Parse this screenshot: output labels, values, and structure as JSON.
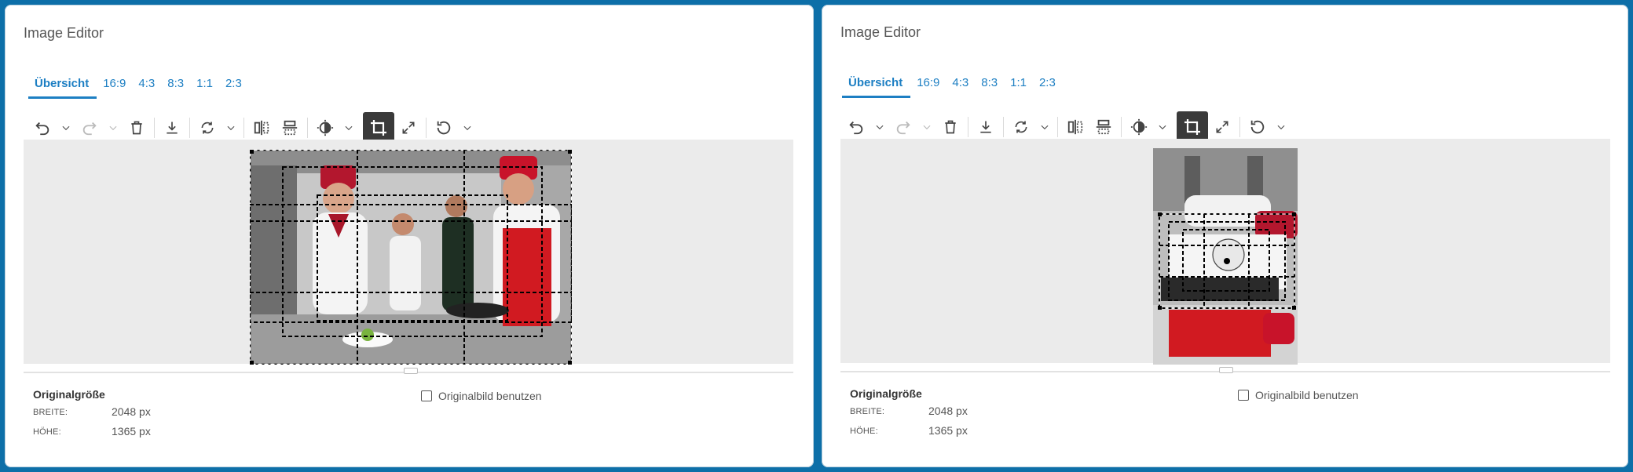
{
  "panels": [
    {
      "title": "Image Editor",
      "tabs": [
        "Übersicht",
        "16:9",
        "4:3",
        "8:3",
        "1:1",
        "2:3"
      ],
      "active_tab": "Übersicht",
      "toolbar": {
        "buttons": [
          "undo-icon",
          "redo-icon",
          "delete-icon",
          "download-icon",
          "rotate-icon",
          "flip-horizontal-icon",
          "flip-vertical-icon",
          "brightness-icon",
          "crop-icon",
          "fullscreen-icon",
          "reset-icon"
        ],
        "active": "crop-icon",
        "disabled": [
          "redo-icon"
        ]
      },
      "image_orientation": "landscape",
      "original": {
        "heading": "Originalgröße",
        "width_label": "BREITE:",
        "width_value": "2048 px",
        "height_label": "HÖHE:",
        "height_value": "1365 px",
        "use_original_label": "Originalbild benutzen",
        "use_original_checked": false
      }
    },
    {
      "title": "Image Editor",
      "tabs": [
        "Übersicht",
        "16:9",
        "4:3",
        "8:3",
        "1:1",
        "2:3"
      ],
      "active_tab": "Übersicht",
      "toolbar": {
        "buttons": [
          "undo-icon",
          "redo-icon",
          "delete-icon",
          "download-icon",
          "rotate-icon",
          "flip-horizontal-icon",
          "flip-vertical-icon",
          "brightness-icon",
          "crop-icon",
          "fullscreen-icon",
          "reset-icon"
        ],
        "active": "crop-icon",
        "disabled": [
          "redo-icon"
        ]
      },
      "image_orientation": "rotated-90",
      "original": {
        "heading": "Originalgröße",
        "width_label": "BREITE:",
        "width_value": "2048 px",
        "height_label": "HÖHE:",
        "height_value": "1365 px",
        "use_original_label": "Originalbild benutzen",
        "use_original_checked": false
      }
    }
  ],
  "colors": {
    "background": "#0d6fa8",
    "accent": "#1d7fc3",
    "stage": "#ebebeb",
    "active_tool": "#3a3a3a"
  }
}
